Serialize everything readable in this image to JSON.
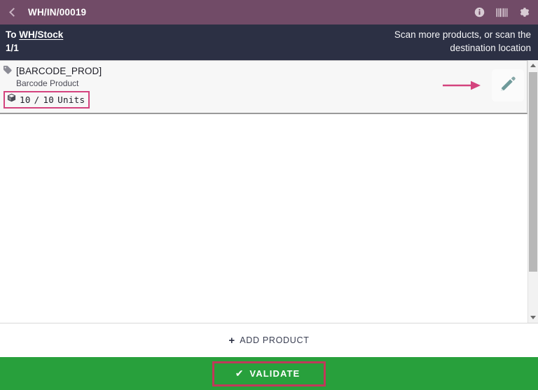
{
  "header": {
    "title": "WH/IN/00019",
    "back_icon": "chevron-left-icon",
    "actions": [
      {
        "name": "info-icon",
        "label": "Information"
      },
      {
        "name": "barcode-icon",
        "label": "Barcode"
      },
      {
        "name": "gear-icon",
        "label": "Settings"
      }
    ]
  },
  "info_bar": {
    "destination_label": "To",
    "destination_value": "WH/Stock",
    "counter": "1/1",
    "instruction_line1": "Scan more products, or scan the",
    "instruction_line2": "destination location"
  },
  "product_line": {
    "tag_icon": "tag-icon",
    "code": "[BARCODE_PROD]",
    "name": "Barcode Product",
    "box_icon": "package-icon",
    "quantity_done": "10",
    "quantity_separator": "/",
    "quantity_total": "10",
    "uom": "Units",
    "edit_icon": "pencil-icon",
    "hint_arrow_icon": "arrow-right-icon"
  },
  "footer": {
    "add_plus": "+",
    "add_label": "ADD PRODUCT",
    "validate_check": "✔",
    "validate_label": "VALIDATE"
  },
  "scrollbar": {
    "up_icon": "scroll-up-arrow-icon",
    "down_icon": "scroll-down-arrow-icon"
  },
  "colors": {
    "header_purple": "#714B67",
    "info_navy": "#2C3044",
    "validate_green": "#28A03C",
    "highlight_pink": "#d4437e",
    "highlight_red": "#c0395a",
    "arrow_pink": "#d4437e",
    "pencil_teal": "#6f9a9a"
  }
}
